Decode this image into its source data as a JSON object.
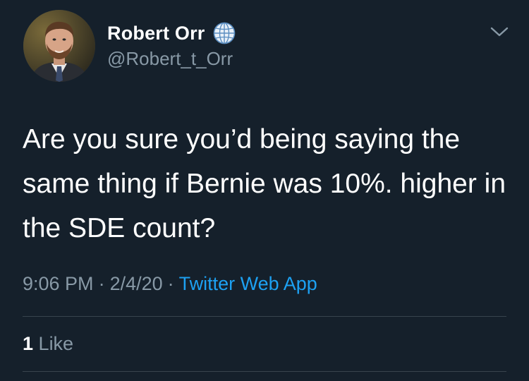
{
  "author": {
    "display_name": "Robert Orr",
    "handle": "@Robert_t_Orr",
    "badge_icon": "globe-icon"
  },
  "tweet": {
    "text": "Are you sure you’d being saying the same thing if Bernie was 10%. higher in the SDE count?",
    "time": "9:06 PM",
    "separator": "·",
    "date": "2/4/20",
    "source": "Twitter Web App",
    "likes_count": "1",
    "likes_label": "Like"
  },
  "colors": {
    "background": "#15202b",
    "secondary_text": "#8899a6",
    "accent": "#1da1f2",
    "divider": "#38444d"
  }
}
